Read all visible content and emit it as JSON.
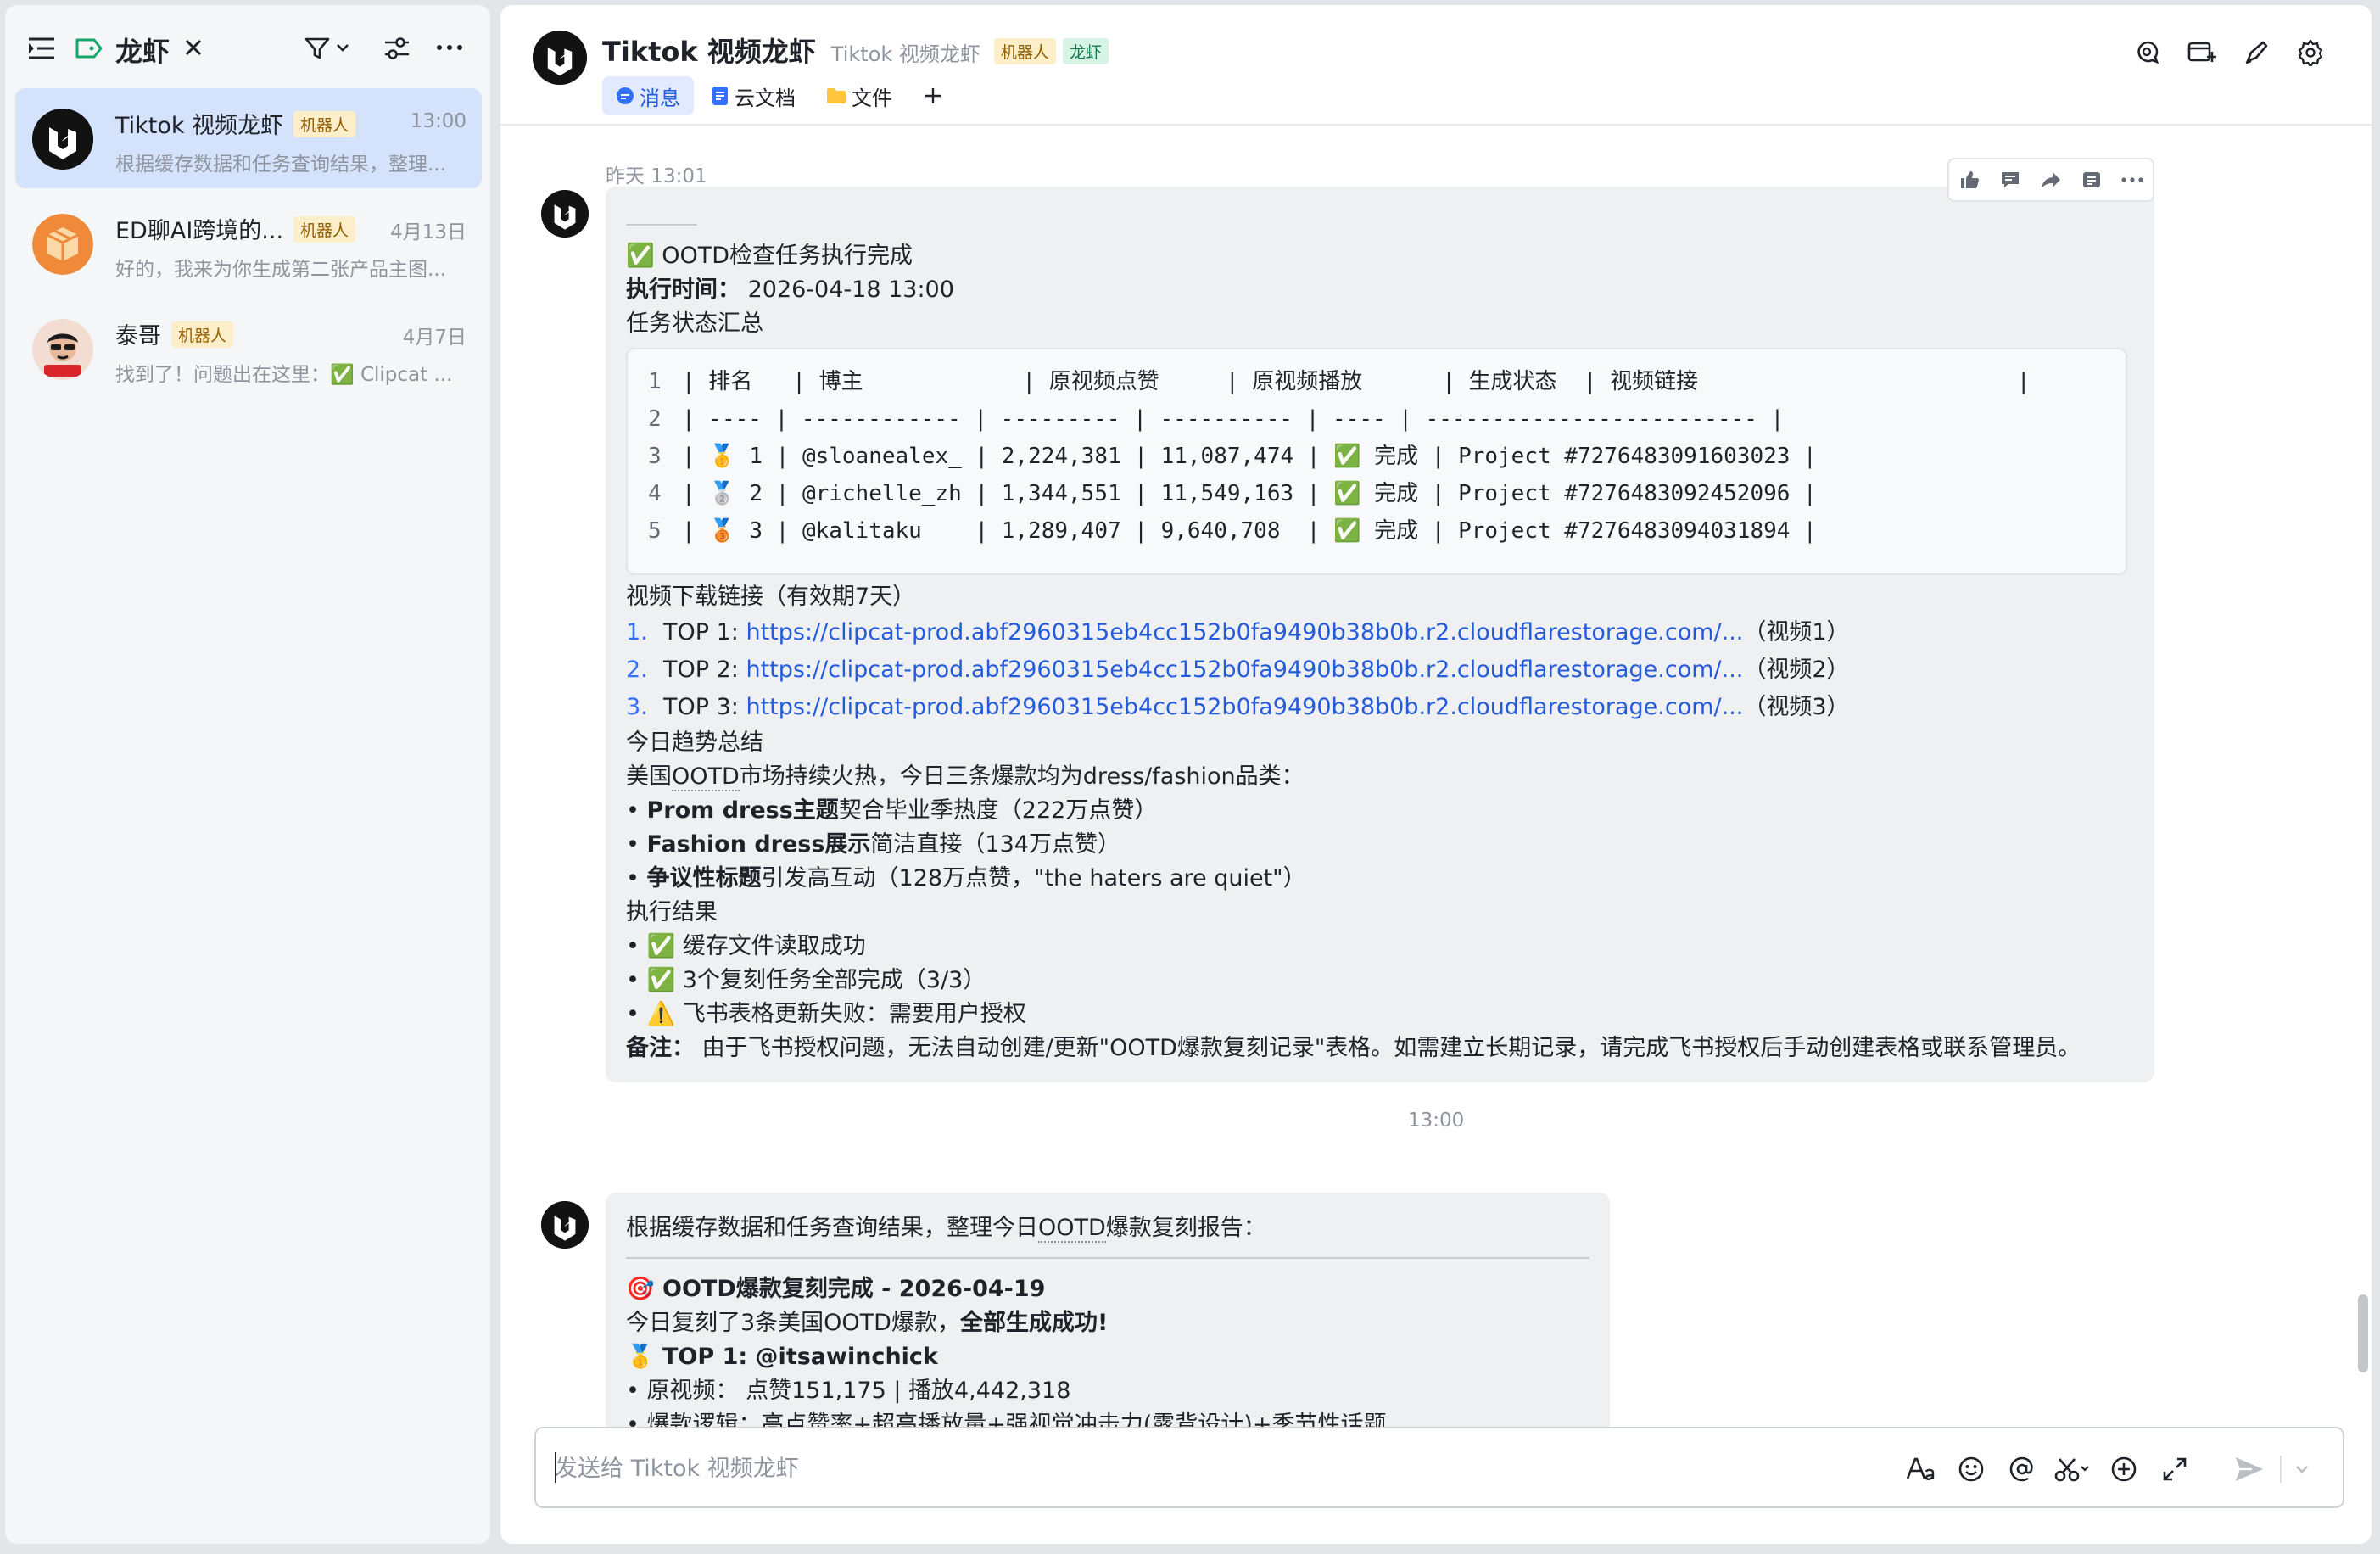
{
  "sidebar": {
    "title": "龙虾",
    "chats": [
      {
        "name": "Tiktok 视频龙虾",
        "badge": "机器人",
        "time": "13:00",
        "preview": "根据缓存数据和任务查询结果，整理...",
        "active": true
      },
      {
        "name": "ED聊AI跨境的...",
        "badge": "机器人",
        "time": "4月13日",
        "preview": "好的，我来为你生成第二张产品主图..."
      },
      {
        "name": "泰哥",
        "badge": "机器人",
        "time": "4月7日",
        "preview": "找到了！问题出在这里：✅ Clipcat ..."
      }
    ]
  },
  "header": {
    "title": "Tiktok 视频龙虾",
    "subtitle": "Tiktok 视频龙虾",
    "tag_bot": "机器人",
    "tag_lobster": "龙虾",
    "tabs": [
      {
        "label": "消息",
        "active": true
      },
      {
        "label": "云文档"
      },
      {
        "label": "文件"
      }
    ]
  },
  "message1": {
    "time": "昨天 13:01",
    "title": "✅ OOTD检查任务执行完成",
    "exec_label": "执行时间：",
    "exec_value": "2026-04-18 13:00",
    "summary_heading": "任务状态汇总",
    "code_lines": [
      {
        "n": "1",
        "text": "| 排名   | 博主            | 原视频点赞     | 原视频播放      | 生成状态  | 视频链接                        |"
      },
      {
        "n": "2",
        "text": "| ---- | ------------ | --------- | ---------- | ---- | ------------------------- |"
      },
      {
        "n": "3",
        "text": "| 🥇 1 | @sloanealex_ | 2,224,381 | 11,087,474 | ✅ 完成 | Project #7276483091603023 |"
      },
      {
        "n": "4",
        "text": "| 🥈 2 | @richelle_zh | 1,344,551 | 11,549,163 | ✅ 完成 | Project #7276483092452096 |"
      },
      {
        "n": "5",
        "text": "| 🥉 3 | @kalitaku    | 1,289,407 | 9,640,708  | ✅ 完成 | Project #7276483094031894 |"
      }
    ],
    "download_heading": "视频下载链接（有效期7天）",
    "links": [
      {
        "num": "1.",
        "label": "TOP 1: ",
        "url": "https://clipcat-prod.abf2960315eb4cc152b0fa9490b38b0b.r2.cloudflarestorage.com/...",
        "suffix": "（视频1）"
      },
      {
        "num": "2.",
        "label": "TOP 2: ",
        "url": "https://clipcat-prod.abf2960315eb4cc152b0fa9490b38b0b.r2.cloudflarestorage.com/...",
        "suffix": "（视频2）"
      },
      {
        "num": "3.",
        "label": "TOP 3: ",
        "url": "https://clipcat-prod.abf2960315eb4cc152b0fa9490b38b0b.r2.cloudflarestorage.com/...",
        "suffix": "（视频3）"
      }
    ],
    "trend_heading": "今日趋势总结",
    "trend_intro_a": "美国",
    "trend_intro_b": "OOTD",
    "trend_intro_c": "市场持续火热，今日三条爆款均为dress/fashion品类：",
    "trends": [
      {
        "bold": "Prom dress主题",
        "rest": "契合毕业季热度（222万点赞）"
      },
      {
        "bold": "Fashion dress展示",
        "rest": "简洁直接（134万点赞）"
      },
      {
        "bold": "争议性标题",
        "rest": "引发高互动（128万点赞，\"the haters are quiet\"）"
      }
    ],
    "result_heading": "执行结果",
    "results": [
      "✅ 缓存文件读取成功",
      "✅ 3个复刻任务全部完成（3/3）",
      "⚠️ 飞书表格更新失败：需要用户授权"
    ],
    "note_label": "备注：",
    "note_text": " 由于飞书授权问题，无法自动创建/更新\"OOTD爆款复刻记录\"表格。如需建立长期记录，请完成飞书授权后手动创建表格或联系管理员。"
  },
  "message2": {
    "time": "13:00",
    "intro_a": "根据缓存数据和任务查询结果，整理今日",
    "intro_b": "OOTD",
    "intro_c": "爆款复刻报告：",
    "heading": "🎯 OOTD爆款复刻完成 - 2026-04-19",
    "line1_a": "今日复刻了3条美国OOTD爆款，",
    "line1_b": "全部生成成功!",
    "top1": "🥇 TOP 1: @itsawinchick",
    "orig": "• 原视频： 点赞151,175 | 播放4,442,318",
    "logic": "• 爆款逻辑：高点赞率+超高播放量+强视觉冲击力(露背设计)+季节性话题"
  },
  "composer": {
    "placeholder": "发送给 Tiktok 视频龙虾"
  }
}
